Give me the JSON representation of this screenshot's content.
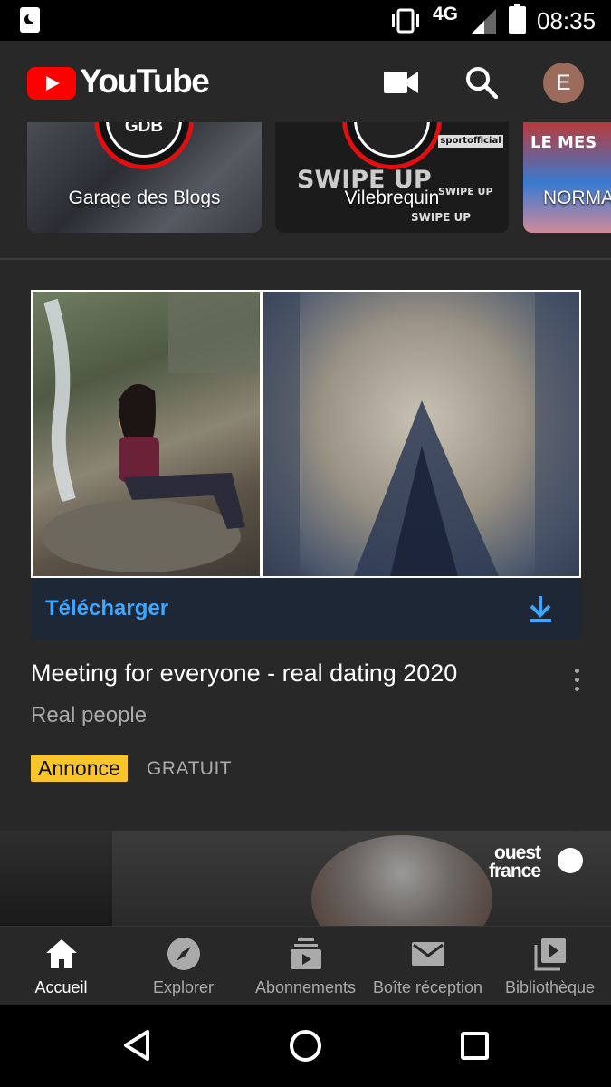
{
  "status_bar": {
    "network": "4G",
    "time": "08:35"
  },
  "app_bar": {
    "logo_text": "YouTube",
    "avatar_initial": "E"
  },
  "stories": [
    {
      "label": "Garage des Blogs",
      "logo_text": "GDB"
    },
    {
      "label": "Vilebrequin",
      "logo_text": "",
      "overlay": [
        "SWIPE UP",
        "SWIPE UP",
        "SWIPE UP"
      ],
      "tag": "sportofficial"
    },
    {
      "label": "NORMA",
      "overlay_text": "LE MES"
    }
  ],
  "ad": {
    "download_label": "Télécharger",
    "title": "Meeting for everyone - real dating 2020",
    "subtitle": "Real people",
    "badge": "Annonce",
    "price": "GRATUIT"
  },
  "next_video": {
    "channel_logo": [
      "ouest",
      "france"
    ]
  },
  "bottom_nav": {
    "items": [
      {
        "label": "Accueil",
        "icon": "home-icon",
        "active": true
      },
      {
        "label": "Explorer",
        "icon": "compass-icon",
        "active": false
      },
      {
        "label": "Abonnements",
        "icon": "subscriptions-icon",
        "active": false
      },
      {
        "label": "Boîte réception",
        "icon": "inbox-icon",
        "active": false
      },
      {
        "label": "Bibliothèque",
        "icon": "library-icon",
        "active": false
      }
    ]
  },
  "colors": {
    "background": "#282828",
    "brand_red": "#ff0000",
    "link_blue": "#3ea6ff",
    "ad_badge": "#f9c52b"
  }
}
